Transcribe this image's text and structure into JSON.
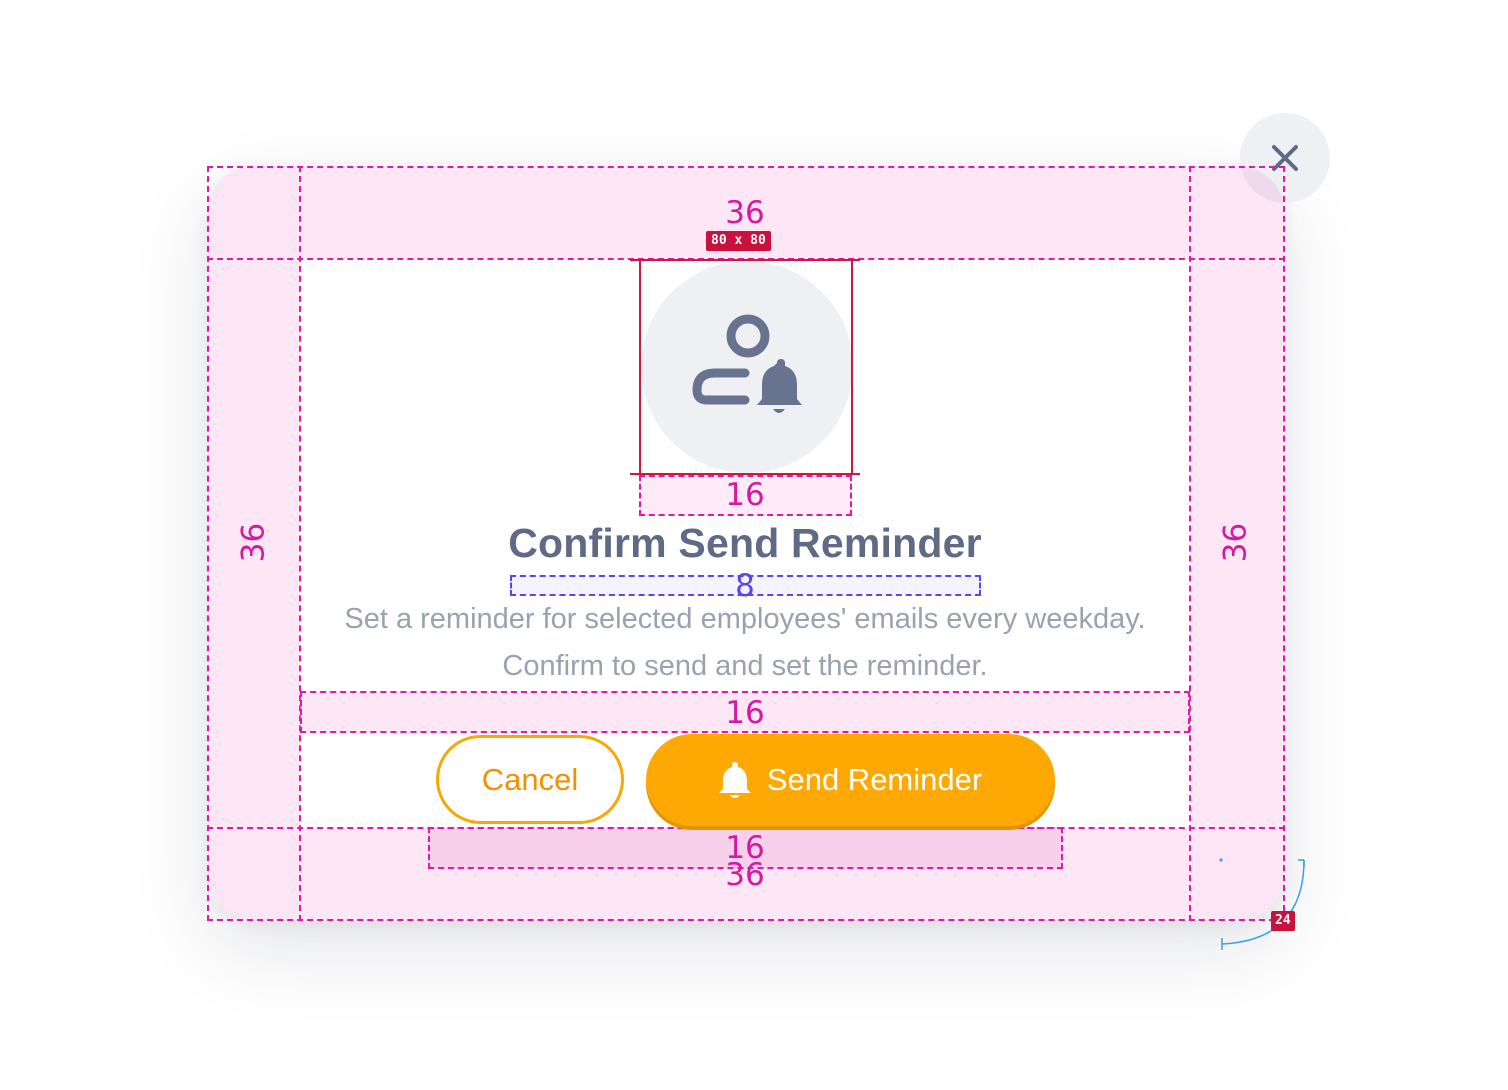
{
  "dialog": {
    "title": "Confirm Send Reminder",
    "description_line1": "Set a reminder for selected employees' emails every weekday.",
    "description_line2": "Confirm to send and set the reminder.",
    "cancel_label": "Cancel",
    "confirm_label": "Send Reminder",
    "close_glyph": "X",
    "icon": "user-bell-icon"
  },
  "annotations": {
    "padding_top": "36",
    "padding_left": "36",
    "padding_right": "36",
    "padding_bottom": "36",
    "icon_size": "80 x 80",
    "gap_icon_title": "16",
    "gap_title_description": "8",
    "gap_description_buttons": "16",
    "gap_buttons_bottom": "16",
    "corner_radius": "24"
  },
  "colors": {
    "accent": "#fea903",
    "title": "#5e6a86",
    "text_muted": "#9aa1b0",
    "icon": "#67738f",
    "spacing_overlay": "#e01aa6",
    "size_tag": "#c8113c",
    "gap_small": "#5b46ee"
  }
}
